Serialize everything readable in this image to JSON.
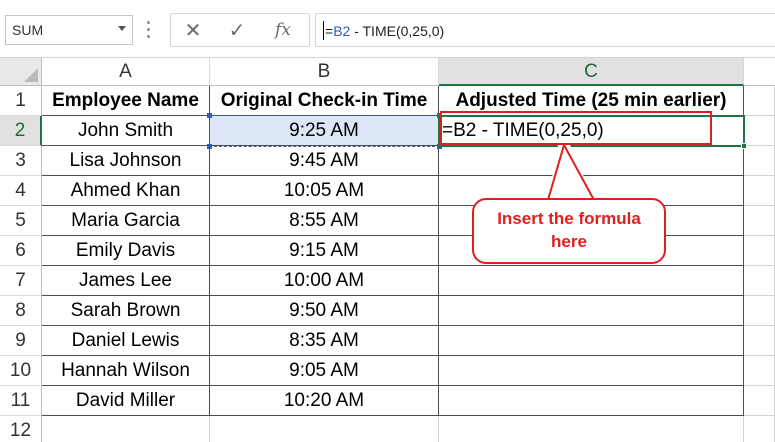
{
  "name_box": {
    "value": "SUM"
  },
  "formula_bar": {
    "cancel_symbol": "✕",
    "enter_symbol": "✓",
    "fx_label": "fx",
    "formula_prefix": "=",
    "formula_ref": "B2",
    "formula_rest": " - TIME(0,25,0)"
  },
  "columns": [
    "A",
    "B",
    "C"
  ],
  "rows": [
    "1",
    "2",
    "3",
    "4",
    "5",
    "6",
    "7",
    "8",
    "9",
    "10",
    "11",
    "12"
  ],
  "headers": {
    "a": "Employee Name",
    "b": "Original Check-in Time",
    "c": "Adjusted Time (25 min earlier)"
  },
  "employees": [
    {
      "name": "John Smith",
      "time": "9:25 AM",
      "adjusted": "=B2 - TIME(0,25,0)"
    },
    {
      "name": "Lisa Johnson",
      "time": "9:45 AM",
      "adjusted": ""
    },
    {
      "name": "Ahmed Khan",
      "time": "10:05 AM",
      "adjusted": ""
    },
    {
      "name": "Maria Garcia",
      "time": "8:55 AM",
      "adjusted": ""
    },
    {
      "name": "Emily Davis",
      "time": "9:15 AM",
      "adjusted": ""
    },
    {
      "name": "James Lee",
      "time": "10:00 AM",
      "adjusted": ""
    },
    {
      "name": "Sarah Brown",
      "time": "9:50 AM",
      "adjusted": ""
    },
    {
      "name": "Daniel Lewis",
      "time": "8:35 AM",
      "adjusted": ""
    },
    {
      "name": "Hannah Wilson",
      "time": "9:05 AM",
      "adjusted": ""
    },
    {
      "name": "David Miller",
      "time": "10:20 AM",
      "adjusted": ""
    }
  ],
  "callout": {
    "line1": "Insert the formula",
    "line2": "here"
  },
  "colors": {
    "excel_green": "#217346",
    "reference_blue": "#2e5eb8",
    "annotation_red": "#e02020",
    "ref_cell_fill": "#dce6f7"
  }
}
